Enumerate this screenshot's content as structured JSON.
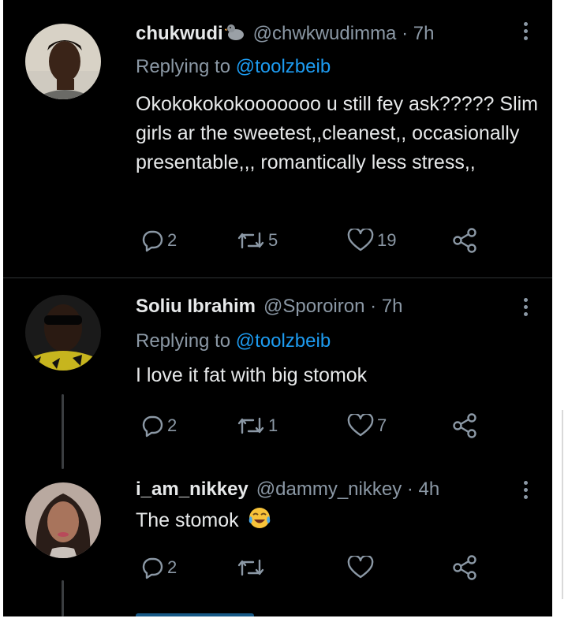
{
  "tweets": [
    {
      "name": "chukwudi",
      "handle": "@chwkwudimma",
      "time": "· 7h",
      "badge_icon": "duck-emoji",
      "reply_prefix": "Replying to ",
      "reply_to": "@toolzbeib",
      "text": "Okokokokokooooooo u still fey ask????? Slim girls ar the sweetest,,cleanest,, occasionally presentable,,, romantically less stress,,",
      "replies": "2",
      "retweets": "5",
      "likes": "19"
    },
    {
      "name": "Soliu Ibrahim",
      "handle": "@Sporoiron",
      "time": "· 7h",
      "reply_prefix": "Replying to ",
      "reply_to": "@toolzbeib",
      "text": "I love it fat with big stomok",
      "replies": "2",
      "retweets": "1",
      "likes": "7"
    },
    {
      "name": "i_am_nikkey",
      "handle": "@dammy_nikkey",
      "time": "· 4h",
      "text": "The stomok",
      "emoji_icon": "tears-of-joy-emoji",
      "replies": "2",
      "retweets": "",
      "likes": ""
    }
  ],
  "icons": {
    "reply": "reply-icon",
    "retweet": "retweet-icon",
    "like": "heart-icon",
    "share": "share-icon",
    "more": "more-icon"
  },
  "colors": {
    "background": "#000000",
    "text": "#e7e9ea",
    "secondary": "#8b98a5",
    "accent": "#1d9bf0",
    "divider": "#2f3336"
  }
}
